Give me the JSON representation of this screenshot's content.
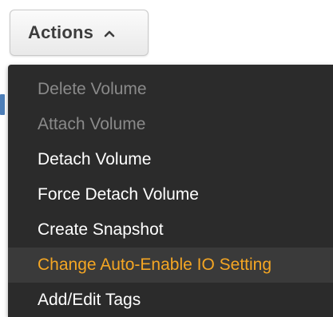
{
  "actions_button": {
    "label": "Actions",
    "icon": "chevron-up-icon"
  },
  "menu": {
    "items": [
      {
        "label": "Delete Volume",
        "enabled": false,
        "highlighted": false
      },
      {
        "label": "Attach Volume",
        "enabled": false,
        "highlighted": false
      },
      {
        "label": "Detach Volume",
        "enabled": true,
        "highlighted": false
      },
      {
        "label": "Force Detach Volume",
        "enabled": true,
        "highlighted": false
      },
      {
        "label": "Create Snapshot",
        "enabled": true,
        "highlighted": false
      },
      {
        "label": "Change Auto-Enable IO Setting",
        "enabled": true,
        "highlighted": true
      },
      {
        "label": "Add/Edit Tags",
        "enabled": true,
        "highlighted": false
      }
    ]
  },
  "colors": {
    "menu_background": "#2b2b2b",
    "highlight_text": "#f5a623",
    "disabled_text": "#8a8a8a",
    "enabled_text": "#ffffff"
  }
}
